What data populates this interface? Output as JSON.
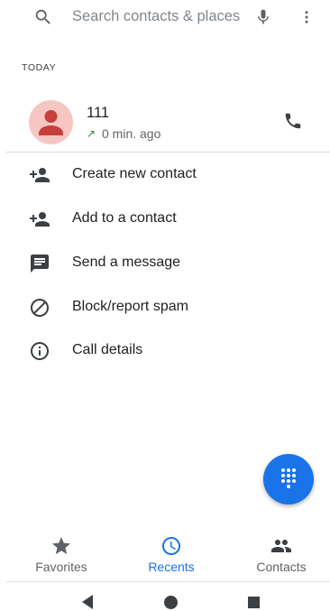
{
  "search": {
    "placeholder": "Search contacts & places"
  },
  "section": {
    "label": "TODAY"
  },
  "call": {
    "name": "111",
    "direction_glyph": "↗",
    "time": "0 min. ago",
    "avatar_color": "#f6c6c3",
    "avatar_figure_color": "#c5403a"
  },
  "actions": [
    {
      "label": "Create new contact",
      "icon": "person-add-icon"
    },
    {
      "label": "Add to a contact",
      "icon": "person-add-icon"
    },
    {
      "label": "Send a message",
      "icon": "message-icon"
    },
    {
      "label": "Block/report spam",
      "icon": "block-icon"
    },
    {
      "label": "Call details",
      "icon": "info-icon"
    }
  ],
  "fab": {
    "icon": "dialpad-icon",
    "color": "#1a73e8"
  },
  "bottom_nav": {
    "items": [
      {
        "label": "Favorites",
        "icon": "star-icon",
        "active": false
      },
      {
        "label": "Recents",
        "icon": "clock-icon",
        "active": true
      },
      {
        "label": "Contacts",
        "icon": "people-icon",
        "active": false
      }
    ],
    "active_color": "#1a73e8",
    "inactive_color": "#5f6368"
  }
}
